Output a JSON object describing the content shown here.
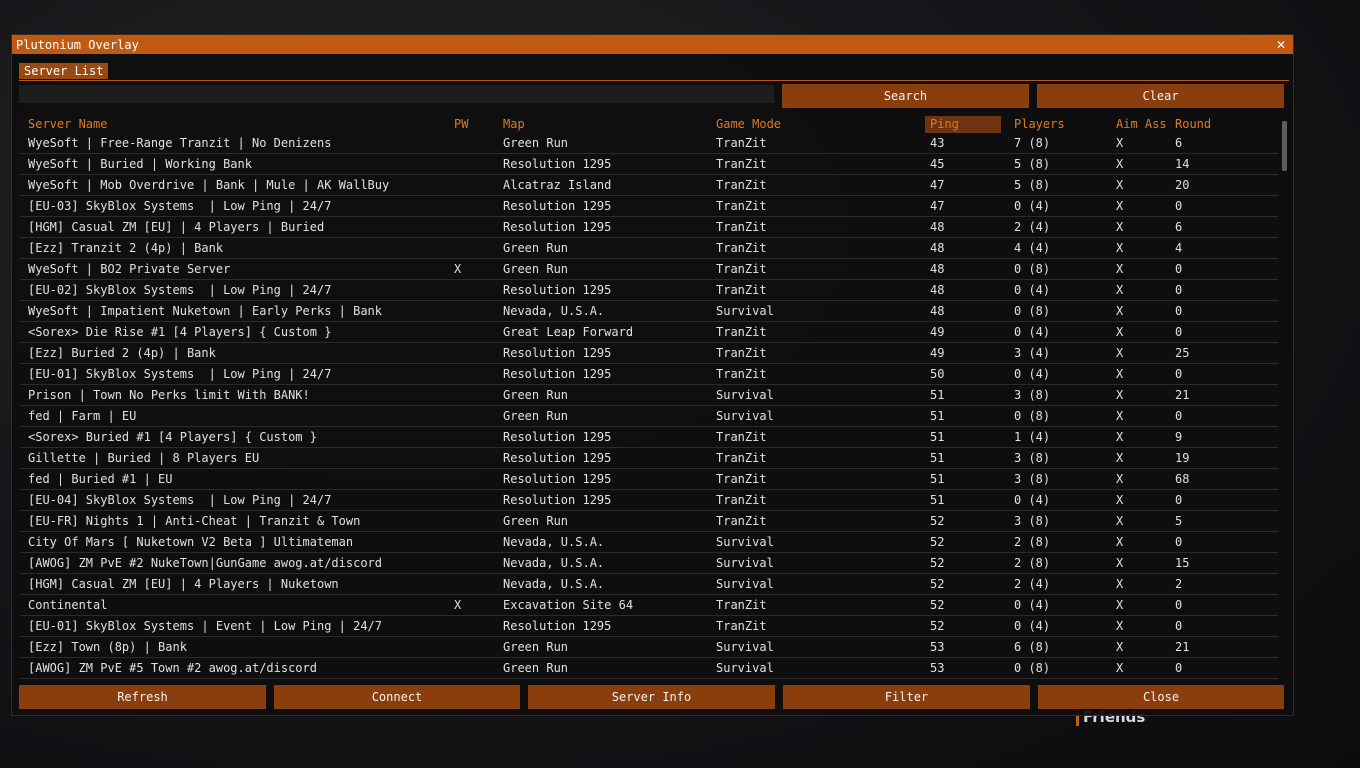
{
  "background": {
    "friends_label": "Friends"
  },
  "window": {
    "title": "Plutonium Overlay",
    "close_glyph": "✕"
  },
  "tabs": [
    {
      "label": "Server List",
      "active": true
    }
  ],
  "search": {
    "value": "",
    "placeholder": "",
    "search_label": "Search",
    "clear_label": "Clear"
  },
  "columns": {
    "name": "Server Name",
    "pw": "PW",
    "map": "Map",
    "mode": "Game Mode",
    "ping": "Ping",
    "players": "Players",
    "aim": "Aim Ass",
    "round": "Round"
  },
  "servers": [
    {
      "name": "WyeSoft | Free-Range Tranzit | No Denizens",
      "pw": "",
      "map": "Green Run",
      "mode": "TranZit",
      "ping": "43",
      "players": "7 (8)",
      "aim": "X",
      "round": "6"
    },
    {
      "name": "WyeSoft | Buried | Working Bank",
      "pw": "",
      "map": "Resolution 1295",
      "mode": "TranZit",
      "ping": "45",
      "players": "5 (8)",
      "aim": "X",
      "round": "14"
    },
    {
      "name": "WyeSoft | Mob Overdrive | Bank | Mule | AK WallBuy",
      "pw": "",
      "map": "Alcatraz Island",
      "mode": "TranZit",
      "ping": "47",
      "players": "5 (8)",
      "aim": "X",
      "round": "20"
    },
    {
      "name": "[EU-03] SkyBlox Systems  | Low Ping | 24/7",
      "pw": "",
      "map": "Resolution 1295",
      "mode": "TranZit",
      "ping": "47",
      "players": "0 (4)",
      "aim": "X",
      "round": "0"
    },
    {
      "name": "[HGM] Casual ZM [EU] | 4 Players | Buried",
      "pw": "",
      "map": "Resolution 1295",
      "mode": "TranZit",
      "ping": "48",
      "players": "2 (4)",
      "aim": "X",
      "round": "6"
    },
    {
      "name": "[Ezz] Tranzit 2 (4p) | Bank",
      "pw": "",
      "map": "Green Run",
      "mode": "TranZit",
      "ping": "48",
      "players": "4 (4)",
      "aim": "X",
      "round": "4"
    },
    {
      "name": "WyeSoft | BO2 Private Server",
      "pw": "X",
      "map": "Green Run",
      "mode": "TranZit",
      "ping": "48",
      "players": "0 (8)",
      "aim": "X",
      "round": "0"
    },
    {
      "name": "[EU-02] SkyBlox Systems  | Low Ping | 24/7",
      "pw": "",
      "map": "Resolution 1295",
      "mode": "TranZit",
      "ping": "48",
      "players": "0 (4)",
      "aim": "X",
      "round": "0"
    },
    {
      "name": "WyeSoft | Impatient Nuketown | Early Perks | Bank",
      "pw": "",
      "map": "Nevada, U.S.A.",
      "mode": "Survival",
      "ping": "48",
      "players": "0 (8)",
      "aim": "X",
      "round": "0"
    },
    {
      "name": "<Sorex> Die Rise #1 [4 Players] { Custom }",
      "pw": "",
      "map": "Great Leap Forward",
      "mode": "TranZit",
      "ping": "49",
      "players": "0 (4)",
      "aim": "X",
      "round": "0"
    },
    {
      "name": "[Ezz] Buried 2 (4p) | Bank",
      "pw": "",
      "map": "Resolution 1295",
      "mode": "TranZit",
      "ping": "49",
      "players": "3 (4)",
      "aim": "X",
      "round": "25"
    },
    {
      "name": "[EU-01] SkyBlox Systems  | Low Ping | 24/7",
      "pw": "",
      "map": "Resolution 1295",
      "mode": "TranZit",
      "ping": "50",
      "players": "0 (4)",
      "aim": "X",
      "round": "0"
    },
    {
      "name": "Prison | Town No Perks limit With BANK!",
      "pw": "",
      "map": "Green Run",
      "mode": "Survival",
      "ping": "51",
      "players": "3 (8)",
      "aim": "X",
      "round": "21"
    },
    {
      "name": "fed | Farm | EU",
      "pw": "",
      "map": "Green Run",
      "mode": "Survival",
      "ping": "51",
      "players": "0 (8)",
      "aim": "X",
      "round": "0"
    },
    {
      "name": "<Sorex> Buried #1 [4 Players] { Custom }",
      "pw": "",
      "map": "Resolution 1295",
      "mode": "TranZit",
      "ping": "51",
      "players": "1 (4)",
      "aim": "X",
      "round": "9"
    },
    {
      "name": "Gillette | Buried | 8 Players EU",
      "pw": "",
      "map": "Resolution 1295",
      "mode": "TranZit",
      "ping": "51",
      "players": "3 (8)",
      "aim": "X",
      "round": "19"
    },
    {
      "name": "fed | Buried #1 | EU",
      "pw": "",
      "map": "Resolution 1295",
      "mode": "TranZit",
      "ping": "51",
      "players": "3 (8)",
      "aim": "X",
      "round": "68"
    },
    {
      "name": "[EU-04] SkyBlox Systems  | Low Ping | 24/7",
      "pw": "",
      "map": "Resolution 1295",
      "mode": "TranZit",
      "ping": "51",
      "players": "0 (4)",
      "aim": "X",
      "round": "0"
    },
    {
      "name": "[EU-FR] Nights 1 | Anti-Cheat | Tranzit & Town",
      "pw": "",
      "map": "Green Run",
      "mode": "TranZit",
      "ping": "52",
      "players": "3 (8)",
      "aim": "X",
      "round": "5"
    },
    {
      "name": "City Of Mars [ Nuketown V2 Beta ] Ultimateman",
      "pw": "",
      "map": "Nevada, U.S.A.",
      "mode": "Survival",
      "ping": "52",
      "players": "2 (8)",
      "aim": "X",
      "round": "0"
    },
    {
      "name": "[AWOG] ZM PvE #2 NukeTown|GunGame awog.at/discord",
      "pw": "",
      "map": "Nevada, U.S.A.",
      "mode": "Survival",
      "ping": "52",
      "players": "2 (8)",
      "aim": "X",
      "round": "15"
    },
    {
      "name": "[HGM] Casual ZM [EU] | 4 Players | Nuketown",
      "pw": "",
      "map": "Nevada, U.S.A.",
      "mode": "Survival",
      "ping": "52",
      "players": "2 (4)",
      "aim": "X",
      "round": "2"
    },
    {
      "name": "Continental",
      "pw": "X",
      "map": "Excavation Site 64",
      "mode": "TranZit",
      "ping": "52",
      "players": "0 (4)",
      "aim": "X",
      "round": "0"
    },
    {
      "name": "[EU-01] SkyBlox Systems | Event | Low Ping | 24/7",
      "pw": "",
      "map": "Resolution 1295",
      "mode": "TranZit",
      "ping": "52",
      "players": "0 (4)",
      "aim": "X",
      "round": "0"
    },
    {
      "name": "[Ezz] Town (8p) | Bank",
      "pw": "",
      "map": "Green Run",
      "mode": "Survival",
      "ping": "53",
      "players": "6 (8)",
      "aim": "X",
      "round": "21"
    },
    {
      "name": "[AWOG] ZM PvE #5 Town #2 awog.at/discord",
      "pw": "",
      "map": "Green Run",
      "mode": "Survival",
      "ping": "53",
      "players": "0 (8)",
      "aim": "X",
      "round": "0"
    }
  ],
  "footer": {
    "refresh": "Refresh",
    "connect": "Connect",
    "server_info": "Server Info",
    "filter": "Filter",
    "close": "Close"
  },
  "colors": {
    "accent": "#c05a10",
    "button": "#8a3e0d",
    "header_text": "#e07a20"
  }
}
